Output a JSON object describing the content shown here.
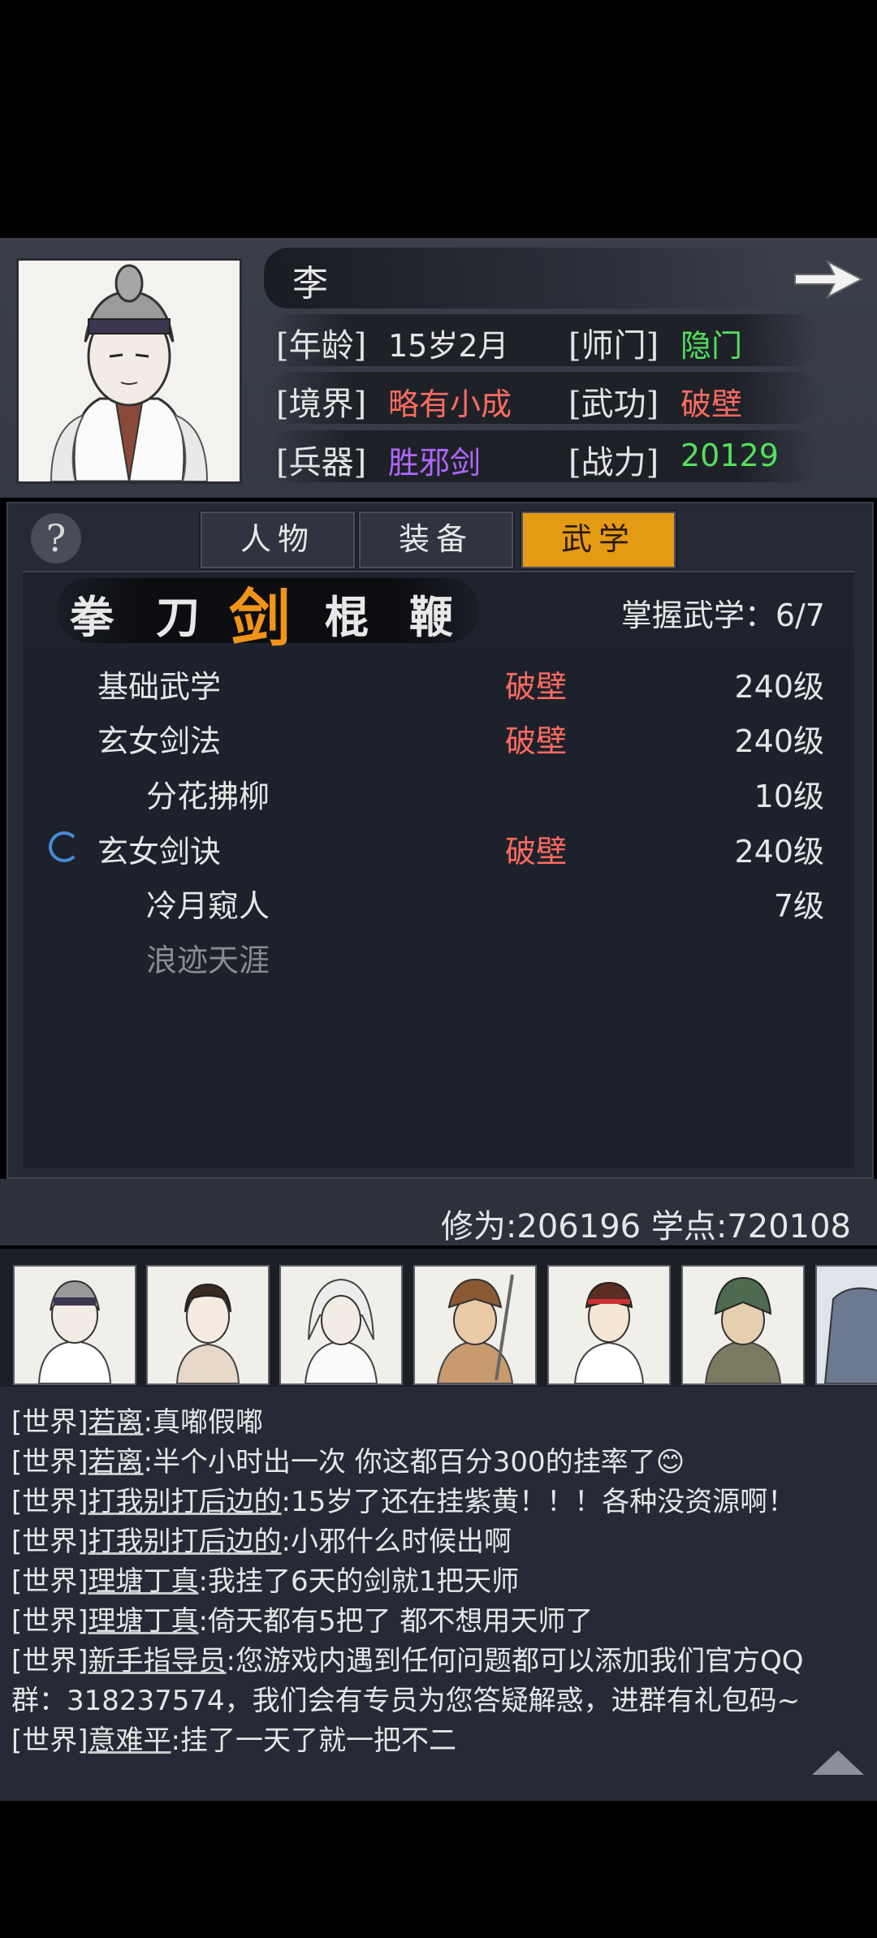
{
  "character": {
    "name": "李",
    "stats": [
      {
        "label": "[年龄]",
        "value": "15岁2月",
        "color": "#e6e6e6"
      },
      {
        "label": "[师门]",
        "value": "隐门",
        "color": "#53e05c"
      },
      {
        "label": "[境界]",
        "value": "略有小成",
        "color": "#ff6b60"
      },
      {
        "label": "[武功]",
        "value": "破壁",
        "color": "#ff6b60"
      },
      {
        "label": "[兵器]",
        "value": "胜邪剑",
        "color": "#b067ff"
      },
      {
        "label": "[战力]",
        "value": "20129",
        "color": "#53e05c"
      }
    ]
  },
  "help_icon": "?",
  "tabs": [
    {
      "label": "人物",
      "active": false
    },
    {
      "label": "装备",
      "active": false
    },
    {
      "label": "武学",
      "active": true
    }
  ],
  "categories": [
    {
      "label": "拳",
      "active": false
    },
    {
      "label": "刀",
      "active": false
    },
    {
      "label": "剑",
      "active": true
    },
    {
      "label": "棍",
      "active": false
    },
    {
      "label": "鞭",
      "active": false
    }
  ],
  "mastery": "掌握武学：6/7",
  "skills": [
    {
      "name": "基础武学",
      "realm": "破壁",
      "level": "240级",
      "indent": false,
      "dim": false
    },
    {
      "name": "玄女剑法",
      "realm": "破壁",
      "level": "240级",
      "indent": false,
      "dim": false
    },
    {
      "name": "分花拂柳",
      "realm": "",
      "level": "10级",
      "indent": true,
      "dim": false
    },
    {
      "name": "玄女剑诀",
      "realm": "破壁",
      "level": "240级",
      "indent": false,
      "dim": false
    },
    {
      "name": "冷月窥人",
      "realm": "",
      "level": "7级",
      "indent": true,
      "dim": false
    },
    {
      "name": "浪迹天涯",
      "realm": "",
      "level": "",
      "indent": true,
      "dim": true
    }
  ],
  "footer_stats": "修为:206196  学点:720108",
  "chat": [
    {
      "tag": "[世界]",
      "user": "若离",
      "text": ":真嘟假嘟"
    },
    {
      "tag": "[世界]",
      "user": "若离",
      "text": ":半个小时出一次 你这都百分300的挂率了😊"
    },
    {
      "tag": "[世界]",
      "user": "打我别打后边的",
      "text": ":15岁了还在挂紫黄！！！各种没资源啊！"
    },
    {
      "tag": "[世界]",
      "user": "打我别打后边的",
      "text": ":小邪什么时候出啊"
    },
    {
      "tag": "[世界]",
      "user": "理塘丁真",
      "text": ":我挂了6天的剑就1把天师"
    },
    {
      "tag": "[世界]",
      "user": "理塘丁真",
      "text": ":倚天都有5把了 都不想用天师了"
    },
    {
      "tag": "[世界]",
      "user": "新手指导员",
      "text": ":您游戏内遇到任何问题都可以添加我们官方QQ"
    },
    {
      "tag": "",
      "user": "",
      "text": "群：318237574，我们会有专员为您答疑解惑，进群有礼包码~"
    },
    {
      "tag": "[世界]",
      "user": "意难平",
      "text": ":挂了一天了就一把不二"
    }
  ]
}
